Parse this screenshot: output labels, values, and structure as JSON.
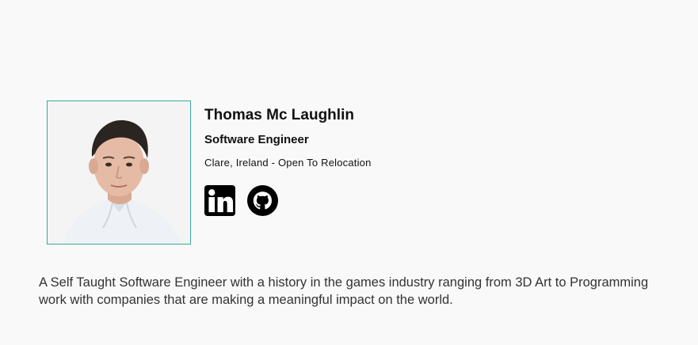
{
  "profile": {
    "name": "Thomas Mc Laughlin",
    "role": "Software Engineer",
    "location": "Clare, Ireland - Open To Relocation",
    "photo_alt": "Profile photo",
    "accent_border": "#3aa89a"
  },
  "socials": [
    {
      "name": "LinkedIn",
      "icon": "linkedin-icon"
    },
    {
      "name": "GitHub",
      "icon": "github-icon"
    }
  ],
  "bio": {
    "line1": "A Self Taught Software Engineer with a history in the games industry ranging from 3D Art to Programming",
    "line2": "work with companies that are making a meaningful impact on the world."
  }
}
